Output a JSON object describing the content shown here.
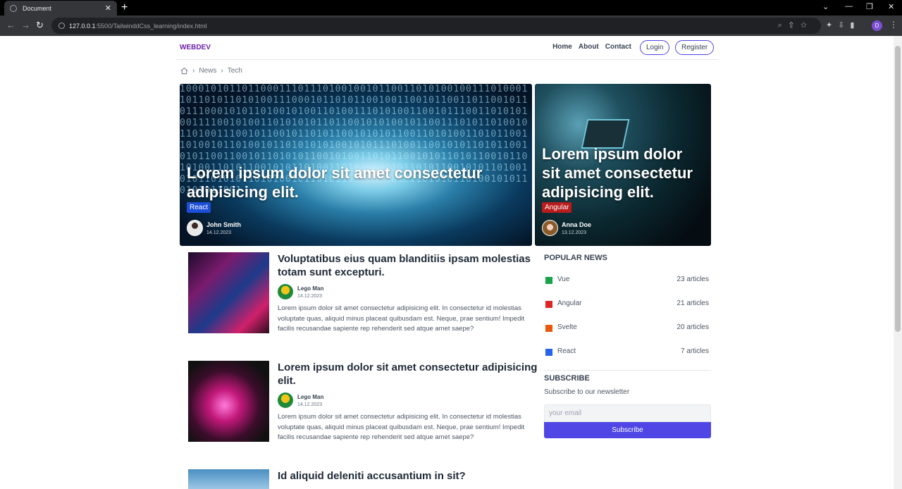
{
  "browser": {
    "tab_title": "Document",
    "url_host": "127.0.0.1",
    "url_path": ":5500/TailwinddCss_learning/index.html",
    "profile_initial": "D"
  },
  "nav": {
    "brand": "WEBDEV",
    "links": [
      "Home",
      "About",
      "Contact"
    ],
    "login": "Login",
    "register": "Register"
  },
  "breadcrumb": [
    "News",
    "Tech"
  ],
  "hero": [
    {
      "title": "Lorem ipsum dolor sit amet consectetur adipisicing elit.",
      "tag": "React",
      "tag_color": "#1d4ed8",
      "author": "John Smith",
      "date": "14.12.2023"
    },
    {
      "title": "Lorem ipsum dolor sit amet consectetur adipisicing elit.",
      "tag": "Angular",
      "tag_color": "#b91c1c",
      "author": "Anna Doe",
      "date": "13.12.2023"
    }
  ],
  "articles": [
    {
      "title": "Voluptatibus eius quam blanditiis ipsam molestias totam sunt excepturi.",
      "author": "Lego Man",
      "date": "14.12.2023",
      "body": "Lorem ipsum dolor sit amet consectetur adipisicing elit. In consectetur id molestias voluptate quas, aliquid minus placeat quibusdam est. Neque, prae sentium! Impedit facilis recusandae sapiente rep rehenderit sed atque amet saepe?"
    },
    {
      "title": "Lorem ipsum dolor sit amet consectetur adipisicing elit.",
      "author": "Lego Man",
      "date": "14.12.2023",
      "body": "Lorem ipsum dolor sit amet consectetur adipisicing elit. In consectetur id molestias voluptate quas, aliquid minus placeat quibusdam est. Neque, prae sentium! Impedit facilis recusandae sapiente rep rehenderit sed atque amet saepe?"
    },
    {
      "title": "Id aliquid deleniti accusantium in sit?"
    }
  ],
  "sidebar": {
    "popular_heading": "POPULAR NEWS",
    "popular": [
      {
        "name": "Vue",
        "count": "23 articles",
        "color": "#16a34a"
      },
      {
        "name": "Angular",
        "count": "21 articles",
        "color": "#dc2626"
      },
      {
        "name": "Svelte",
        "count": "20 articles",
        "color": "#ea580c"
      },
      {
        "name": "React",
        "count": "7 articles",
        "color": "#2563eb"
      }
    ],
    "subscribe_heading": "SUBSCRIBE",
    "subscribe_text": "Subscribe to our newsletter",
    "email_placeholder": "your email",
    "subscribe_button": "Subscribe"
  }
}
